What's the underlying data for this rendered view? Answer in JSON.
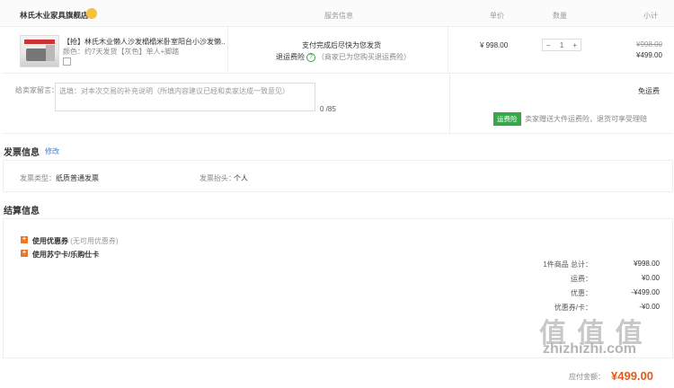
{
  "header": {
    "shop_name": "林氏木业家具旗舰店",
    "col_service": "服务信息",
    "col_price": "单价",
    "col_qty": "数量",
    "col_subtotal": "小计"
  },
  "product": {
    "title": "【抢】林氏木业懒人沙发榻榻米卧室阳台小沙发懒...",
    "attrs": "颜色：约7天发货【灰色】单人+脚踏",
    "service_line1": "支付完成后尽快为您发货",
    "service_line2_label": "退运费险",
    "service_line2_note": "（商家已为您购买退运费险）",
    "unit_price": "¥ 998.00",
    "quantity": "1",
    "original_subtotal": "¥998.00",
    "subtotal": "¥499.00"
  },
  "message": {
    "label": "给卖家留言：",
    "placeholder": "选填：对本次交易的补充说明（所填内容建议已经和卖家达成一致意见）",
    "counter": "0 /85",
    "shipping": "免运费",
    "insurance_badge": "运费险",
    "insurance_text": "卖家赠送大件运费险，退货可享受理赔"
  },
  "invoice": {
    "title": "发票信息",
    "edit_link": "修改",
    "type_label": "发票类型：",
    "type_value": "纸质普通发票",
    "header_label": "发票抬头：",
    "header_value": "个人"
  },
  "settlement": {
    "title": "结算信息",
    "coupon_label": "使用优惠券",
    "coupon_note": "(无可用优惠券)",
    "card_label": "使用苏宁卡/乐购仕卡",
    "summary": [
      {
        "k": "1件商品 总计：",
        "v": "¥998.00"
      },
      {
        "k": "运费：",
        "v": "¥0.00"
      },
      {
        "k": "优惠：",
        "v": "-¥499.00"
      },
      {
        "k": "优惠券/卡：",
        "v": "-¥0.00"
      }
    ],
    "watermark": "值 值 值",
    "watermark_url": "zhizhizhi.com",
    "total_label": "应付金额：",
    "total_value": "¥499.00"
  }
}
